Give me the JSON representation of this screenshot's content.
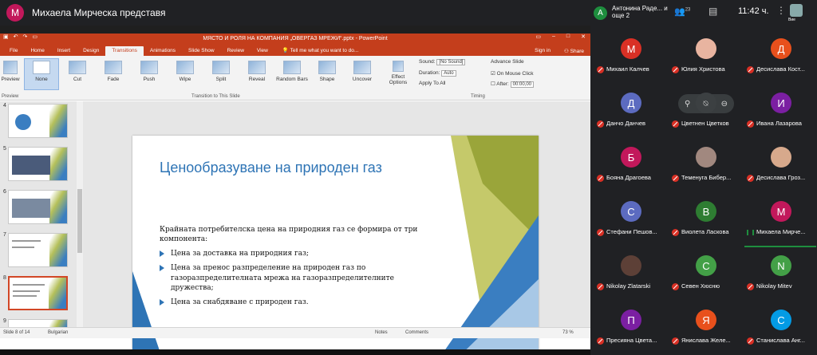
{
  "topbar": {
    "avatar_letter": "M",
    "presenter": "Михаела Мирческа представя",
    "avatar_color": "#c2185b"
  },
  "ppt": {
    "title": "МЯСТО И РОЛЯ НА КОМПАНИЯ „ОВЕРГАЗ МРЕЖИ“.pptx - PowerPoint",
    "tabs": [
      "File",
      "Home",
      "Insert",
      "Design",
      "Transitions",
      "Animations",
      "Slide Show",
      "Review",
      "View"
    ],
    "tellme": "Tell me what you want to do...",
    "signin": "Sign in",
    "share": "Share",
    "ribbon": {
      "preview": "Preview",
      "preview_group": "Preview",
      "transitions": [
        "None",
        "Cut",
        "Fade",
        "Push",
        "Wipe",
        "Split",
        "Reveal",
        "Random Bars",
        "Shape",
        "Uncover"
      ],
      "effect_options": "Effect Options",
      "group_label": "Transition to This Slide",
      "sound_label": "Sound:",
      "sound_value": "[No Sound]",
      "duration_label": "Duration:",
      "duration_value": "Auto",
      "apply_all": "Apply To All",
      "advance": "Advance Slide",
      "on_click": "On Mouse Click",
      "after": "After:",
      "after_value": "00:00,00",
      "timing": "Timing"
    },
    "thumb_numbers": [
      "4",
      "5",
      "6",
      "7",
      "8",
      "9"
    ],
    "slide": {
      "title": "Ценообразуване на природен газ",
      "intro": "Крайната потребителска цена на природния газ се формира от три компонента:",
      "bullets": [
        "Цена за доставка на природния газ;",
        "Цена за пренос разпределение на природен газ по газоразпределителната мрежа на газоразпределителните дружества;",
        "Цена за снабдяване с природен газ."
      ]
    },
    "status": {
      "slide": "Slide 8 of 14",
      "lang": "Bulgarian",
      "notes": "Notes",
      "comments": "Comments",
      "zoom": "73 %"
    }
  },
  "sidebar": {
    "avatar_letter": "А",
    "names": "Антонина Раде... и още 2",
    "people_count": "23",
    "clock": "11:42 ч.",
    "self_label": "Вие"
  },
  "participants": [
    {
      "letter": "М",
      "name": "Михаил Калчев",
      "color": "#d93025"
    },
    {
      "letter": "",
      "name": "Юлия Христова",
      "color": "#e8b4a0"
    },
    {
      "letter": "Д",
      "name": "Десислава Кост...",
      "color": "#e8501c"
    },
    {
      "letter": "Д",
      "name": "Данчо Данчев",
      "color": "#5c6bc0"
    },
    {
      "letter": "",
      "name": "Цветнен Цветков",
      "color": "#3c4043"
    },
    {
      "letter": "И",
      "name": "Ивана Лазарова",
      "color": "#7b1fa2"
    },
    {
      "letter": "Б",
      "name": "Бояна Драгоева",
      "color": "#c2185b"
    },
    {
      "letter": "",
      "name": "Теменуга Бибер...",
      "color": "#a1887f"
    },
    {
      "letter": "",
      "name": "Десислава Гроз...",
      "color": "#d7a98c"
    },
    {
      "letter": "С",
      "name": "Стефани Пешов...",
      "color": "#5c6bc0"
    },
    {
      "letter": "В",
      "name": "Виолета Ласкова",
      "color": "#2e7d32"
    },
    {
      "letter": "М",
      "name": "Михаела Мирче...",
      "color": "#c2185b"
    },
    {
      "letter": "",
      "name": "Nikolay Zlatarski",
      "color": "#5d4037"
    },
    {
      "letter": "С",
      "name": "Севен Хюсню",
      "color": "#43a047"
    },
    {
      "letter": "N",
      "name": "Nikolay Mitev",
      "color": "#43a047"
    },
    {
      "letter": "П",
      "name": "Пресияна Цвета...",
      "color": "#7b1fa2"
    },
    {
      "letter": "Я",
      "name": "Янислава Желе...",
      "color": "#e8501c"
    },
    {
      "letter": "С",
      "name": "Станислава Анг...",
      "color": "#039be5"
    }
  ]
}
